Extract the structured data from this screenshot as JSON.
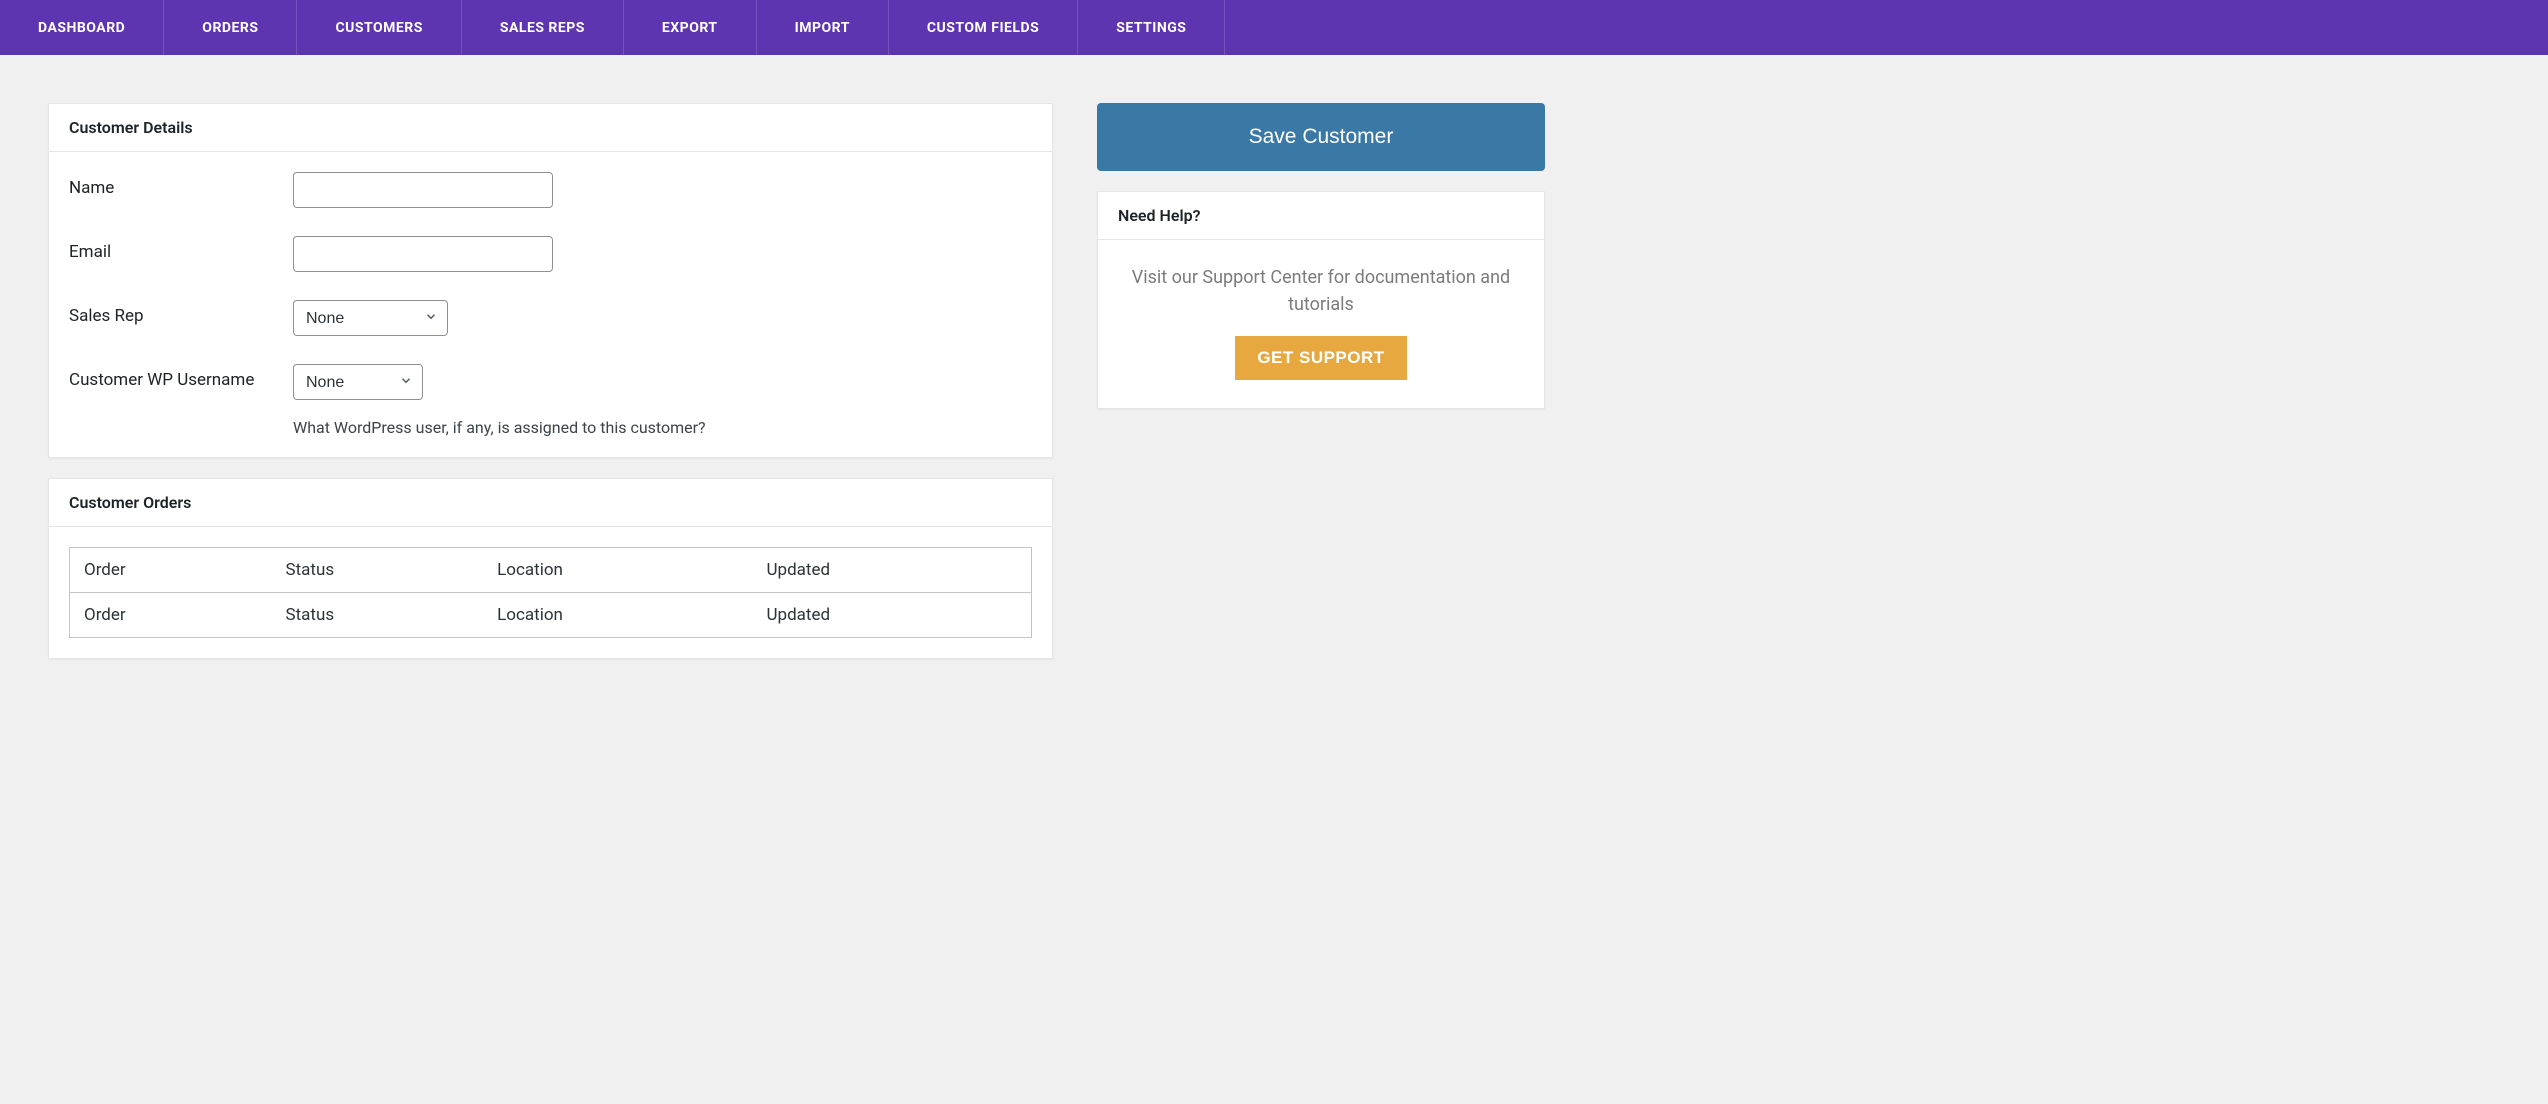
{
  "nav": {
    "items": [
      "DASHBOARD",
      "ORDERS",
      "CUSTOMERS",
      "SALES REPS",
      "EXPORT",
      "IMPORT",
      "CUSTOM FIELDS",
      "SETTINGS"
    ]
  },
  "details_panel": {
    "title": "Customer Details",
    "name_label": "Name",
    "name_value": "",
    "email_label": "Email",
    "email_value": "",
    "salesrep_label": "Sales Rep",
    "salesrep_selected": "None",
    "wpuser_label": "Customer WP Username",
    "wpuser_selected": "None",
    "wpuser_help": "What WordPress user, if any, is assigned to this customer?"
  },
  "orders_panel": {
    "title": "Customer Orders",
    "columns": {
      "order": "Order",
      "status": "Status",
      "location": "Location",
      "updated": "Updated"
    }
  },
  "sidebar": {
    "save_label": "Save Customer",
    "help_title": "Need Help?",
    "help_text": "Visit our Support Center for documentation and tutorials",
    "support_button": "GET SUPPORT"
  }
}
